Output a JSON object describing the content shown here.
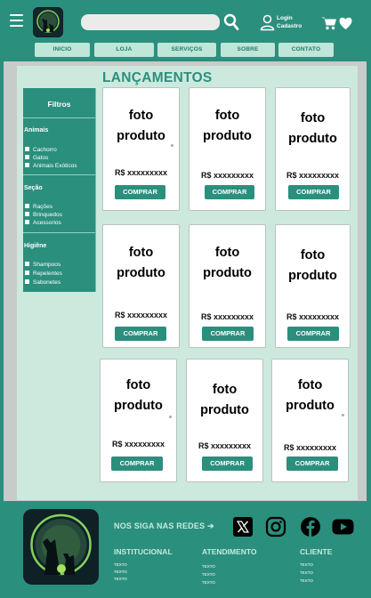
{
  "header": {
    "search_placeholder": "",
    "login_line1": "Login",
    "login_line2": "Cadastro"
  },
  "nav": {
    "items": [
      "INICIO",
      "LOJA",
      "SERVIÇOS",
      "SOBRE",
      "CONTATO"
    ]
  },
  "main": {
    "title": "LANÇAMENTOS"
  },
  "filters": {
    "title": "Filtros",
    "groups": [
      {
        "title": "Animais",
        "options": [
          "Cachorro",
          "Gatos",
          "Animais Exóticos"
        ]
      },
      {
        "title": "Seção",
        "options": [
          "Rações",
          "Brinquedos",
          "Acessorios"
        ]
      },
      {
        "title": "Higiêne",
        "options": [
          "Shampoos",
          "Repelentes",
          "Sabonetes"
        ]
      }
    ]
  },
  "products": [
    {
      "photo": "foto\nproduto",
      "price": "R$ xxxxxxxxx",
      "button": "COMPRAR"
    },
    {
      "photo": "foto\nproduto",
      "price": "R$ xxxxxxxxx",
      "button": "COMPRAR"
    },
    {
      "photo": "foto\nproduto",
      "price": "R$ xxxxxxxxx",
      "button": "COMPRAR"
    },
    {
      "photo": "foto\nproduto",
      "price": "R$ xxxxxxxxx",
      "button": "COMPRAR"
    },
    {
      "photo": "foto\nproduto",
      "price": "R$ xxxxxxxxx",
      "button": "COMPRAR"
    },
    {
      "photo": "foto\nproduto",
      "price": "R$ xxxxxxxxx",
      "button": "COMPRAR"
    },
    {
      "photo": "foto\nproduto",
      "price": "R$ xxxxxxxxx",
      "button": "COMPRAR"
    },
    {
      "photo": "foto\nproduto",
      "price": "R$ xxxxxxxxx",
      "button": "COMPRAR"
    },
    {
      "photo": "foto\nproduto",
      "price": "R$ xxxxxxxxx",
      "button": "COMPRAR"
    }
  ],
  "footer": {
    "follow_label": "NOS SIGA NAS REDES ➔",
    "social_icons": [
      "x-icon",
      "instagram-icon",
      "facebook-icon",
      "youtube-icon"
    ],
    "columns": [
      {
        "title": "INSTITUCIONAL",
        "items": [
          "TEXTO",
          "TEXTO",
          "TEXTO"
        ]
      },
      {
        "title": "ATENDIMENTO",
        "items": [
          "TEXTO",
          "TEXTO",
          "TEXTO"
        ]
      },
      {
        "title": "CLIENTE",
        "items": [
          "TEXTO",
          "TEXTO",
          "TEXTO"
        ]
      }
    ]
  },
  "colors": {
    "brand": "#2b8f7d",
    "panel": "#cde9de",
    "nav_button": "#bfe6d8",
    "frame": "#c7cbc9"
  }
}
